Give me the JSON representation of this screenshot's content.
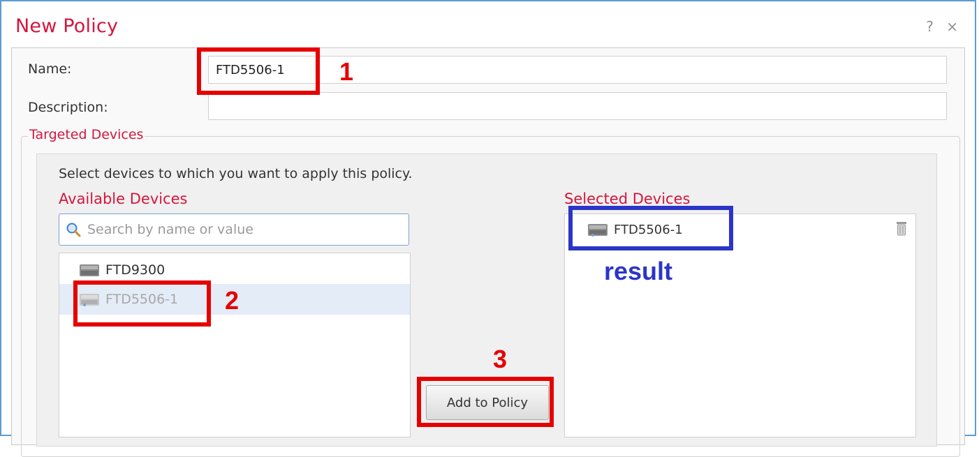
{
  "dialog": {
    "title": "New Policy",
    "help_glyph": "?",
    "close_glyph": "×"
  },
  "form": {
    "name_label": "Name:",
    "name_value": "FTD5506-1",
    "description_label": "Description:",
    "description_value": ""
  },
  "targeted_devices": {
    "legend": "Targeted Devices",
    "hint": "Select devices to which you want to apply this policy.",
    "available": {
      "label": "Available Devices",
      "search_placeholder": "Search by name or value",
      "items": [
        {
          "name": "FTD9300",
          "selected": false
        },
        {
          "name": "FTD5506-1",
          "selected": true
        }
      ]
    },
    "add_button_label": "Add to Policy",
    "selected": {
      "label": "Selected Devices",
      "items": [
        {
          "name": "FTD5506-1"
        }
      ]
    }
  },
  "annotations": {
    "step1": "1",
    "step2": "2",
    "step3": "3",
    "result": "result"
  },
  "colors": {
    "accent_red": "#d4163c",
    "callout_red": "#e60000",
    "callout_blue": "#2b35c9",
    "frame_blue": "#5b9bd5"
  },
  "icons": {
    "search": "search-icon",
    "device": "device-icon",
    "trash": "trash-icon"
  }
}
